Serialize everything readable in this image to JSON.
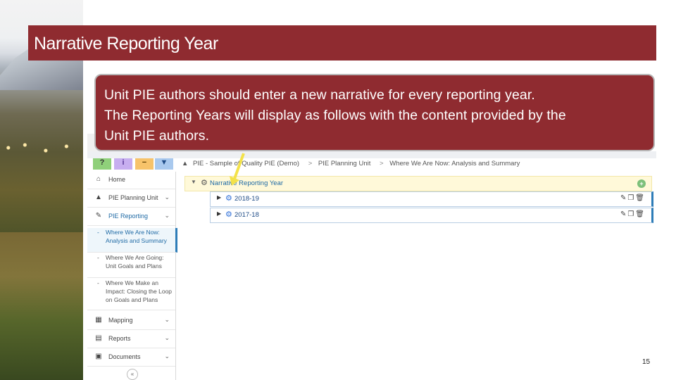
{
  "slide": {
    "title": "Narrative Reporting Year",
    "callout_lines": [
      "Unit PIE authors should enter a new narrative for every reporting year.",
      "The Reporting Years will display as follows with the content provided by the",
      "Unit PIE authors."
    ],
    "page_number": "15"
  },
  "toolbar": {
    "help_label": "?",
    "info_label": "i",
    "minimize_label": "−",
    "filter_label": "▼"
  },
  "sidebar": {
    "items": [
      {
        "icon": "home-icon",
        "label": "Home"
      },
      {
        "icon": "bank-icon",
        "label": "PIE Planning Unit"
      },
      {
        "icon": "pencil-icon",
        "label": "PIE Reporting"
      }
    ],
    "sub_items": [
      {
        "label": "Where We Are Now: Analysis and Summary"
      },
      {
        "label": "Where We Are Going: Unit Goals and Plans"
      },
      {
        "label": "Where We Make an Impact: Closing the Loop on Goals and Plans"
      }
    ],
    "bottom_items": [
      {
        "icon": "sitemap-icon",
        "label": "Mapping"
      },
      {
        "icon": "reports-icon",
        "label": "Reports"
      },
      {
        "icon": "documents-icon",
        "label": "Documents"
      }
    ],
    "collapse_label": "«"
  },
  "breadcrumb": {
    "items": [
      "PIE - Sample of Quality PIE (Demo)",
      "PIE Planning Unit",
      "Where We Are Now: Analysis and Summary"
    ],
    "separator": ">"
  },
  "tree": {
    "root_label": "Narrative Reporting Year",
    "add_label": "+",
    "children": [
      {
        "label": "2018-19"
      },
      {
        "label": "2017-18"
      }
    ]
  },
  "colors": {
    "title_bar": "#8f2b30",
    "callout": "#8f2b30",
    "accent_blue": "#2e7db8",
    "highlight_row": "#fff9d9"
  }
}
